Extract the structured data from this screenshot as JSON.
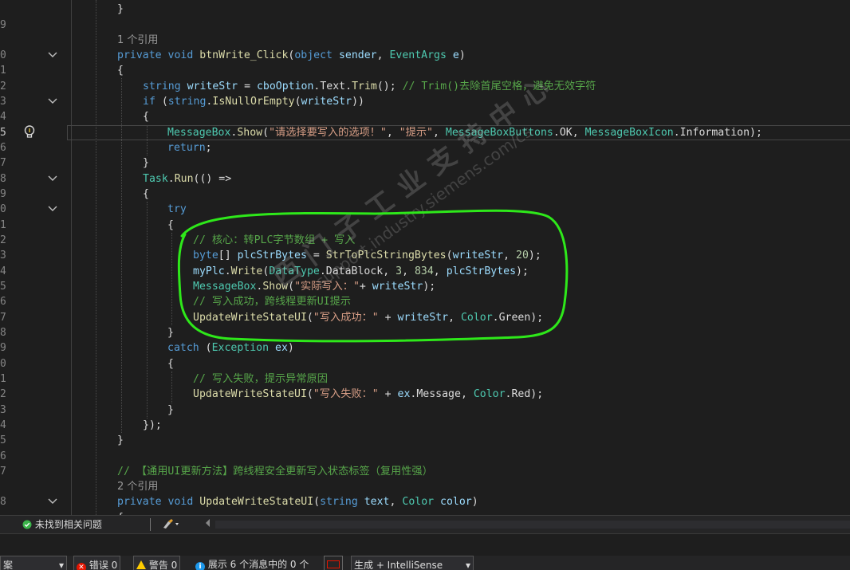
{
  "line_numbers": [
    "",
    "9",
    "",
    "0",
    "1",
    "2",
    "3",
    "4",
    "5",
    "6",
    "7",
    "8",
    "9",
    "0",
    "1",
    "2",
    "3",
    "4",
    "5",
    "6",
    "7",
    "8",
    "9",
    "0",
    "1",
    "2",
    "3",
    "4",
    "5",
    "6",
    "7",
    "",
    "8"
  ],
  "code": {
    "l01": {
      "t1": "}"
    },
    "l03": {
      "t1": "1 个引用"
    },
    "l04": {
      "t1": "private",
      "t2": " ",
      "t3": "void",
      "t4": " ",
      "t5": "btnWrite_Click",
      "t6": "(",
      "t7": "object",
      "t8": " ",
      "t9": "sender",
      "t10": ", ",
      "t11": "EventArgs",
      "t12": " ",
      "t13": "e",
      "t14": ")"
    },
    "l05": {
      "t1": "{"
    },
    "l06": {
      "t1": "string",
      "t2": " ",
      "t3": "writeStr",
      "t4": " = ",
      "t5": "cboOption",
      "t6": ".Text.",
      "t7": "Trim",
      "t8": "(); ",
      "t9": "// Trim()去除首尾空格，避免无效字符"
    },
    "l07": {
      "t1": "if",
      "t2": " (",
      "t3": "string",
      "t4": ".",
      "t5": "IsNullOrEmpty",
      "t6": "(",
      "t7": "writeStr",
      "t8": "))"
    },
    "l08": {
      "t1": "{"
    },
    "l09": {
      "t1": "MessageBox",
      "t2": ".",
      "t3": "Show",
      "t4": "(",
      "t5": "\"请选择要写入的选项！\"",
      "t6": ", ",
      "t7": "\"提示\"",
      "t8": ", ",
      "t9": "MessageBoxButtons",
      "t10": ".OK, ",
      "t11": "MessageBoxIcon",
      "t12": ".Information);"
    },
    "l10": {
      "t1": "return",
      "t2": ";"
    },
    "l11": {
      "t1": "}"
    },
    "l12": {
      "t1": "Task",
      "t2": ".",
      "t3": "Run",
      "t4": "(() =>"
    },
    "l13": {
      "t1": "{"
    },
    "l14": {
      "t1": "try"
    },
    "l15": {
      "t1": "{"
    },
    "l16": {
      "t1": "// 核心：转PLC字节数组 + 写入"
    },
    "l17": {
      "t1": "byte",
      "t2": "[] ",
      "t3": "plcStrBytes",
      "t4": " = ",
      "t5": "StrToPlcStringBytes",
      "t6": "(",
      "t7": "writeStr",
      "t8": ", ",
      "t9": "20",
      "t10": ");"
    },
    "l18": {
      "t1": "myPlc",
      "t2": ".",
      "t3": "Write",
      "t4": "(",
      "t5": "DataType",
      "t6": ".DataBlock, ",
      "t7": "3",
      "t8": ", ",
      "t9": "834",
      "t10": ", ",
      "t11": "plcStrBytes",
      "t12": ");"
    },
    "l19": {
      "t1": "MessageBox",
      "t2": ".",
      "t3": "Show",
      "t4": "(",
      "t5": "\"实际写入：\"",
      "t6": "+ ",
      "t7": "writeStr",
      "t8": ");"
    },
    "l20": {
      "t1": "// 写入成功，跨线程更新UI提示"
    },
    "l21": {
      "t1": "UpdateWriteStateUI",
      "t2": "(",
      "t3": "\"写入成功：\"",
      "t4": " + ",
      "t5": "writeStr",
      "t6": ", ",
      "t7": "Color",
      "t8": ".Green);"
    },
    "l22": {
      "t1": "}"
    },
    "l23": {
      "t1": "catch",
      "t2": " (",
      "t3": "Exception",
      "t4": " ",
      "t5": "ex",
      "t6": ")"
    },
    "l24": {
      "t1": "{"
    },
    "l25": {
      "t1": "// 写入失败，提示异常原因"
    },
    "l26": {
      "t1": "UpdateWriteStateUI",
      "t2": "(",
      "t3": "\"写入失败：\"",
      "t4": " + ",
      "t5": "ex",
      "t6": ".Message, ",
      "t7": "Color",
      "t8": ".Red);"
    },
    "l27": {
      "t1": "}"
    },
    "l28": {
      "t1": "});"
    },
    "l29": {
      "t1": "}"
    },
    "l31": {
      "t1": "// 【通用UI更新方法】跨线程安全更新写入状态标签（复用性强）"
    },
    "l32": {
      "t1": "2 个引用"
    },
    "l33": {
      "t1": "private",
      "t2": " ",
      "t3": "void",
      "t4": " ",
      "t5": "UpdateWriteStateUI",
      "t6": "(",
      "t7": "string",
      "t8": " ",
      "t9": "text",
      "t10": ", ",
      "t11": "Color",
      "t12": " ",
      "t13": "color",
      "t14": ")"
    },
    "l34": {
      "t1": "{"
    }
  },
  "watermark": {
    "line1": "西门子工业支持中心",
    "line2": "support.industry.siemens.com/cs"
  },
  "status_strip": {
    "issues": "未找到相关问题"
  },
  "error_list": {
    "scope_label": "案",
    "errors": "错误 0",
    "warnings": "警告 0",
    "messages": "展示 6 个消息中的 0 个",
    "build_filter": "生成 + IntelliSense"
  },
  "colors": {
    "annotation_circle": "#2ee81a",
    "editor_bg": "#1e1e1e",
    "keyword": "#569cd6",
    "type": "#4ec9b0",
    "method": "#dcdcaa",
    "string": "#d69d85",
    "comment": "#57a64a"
  }
}
